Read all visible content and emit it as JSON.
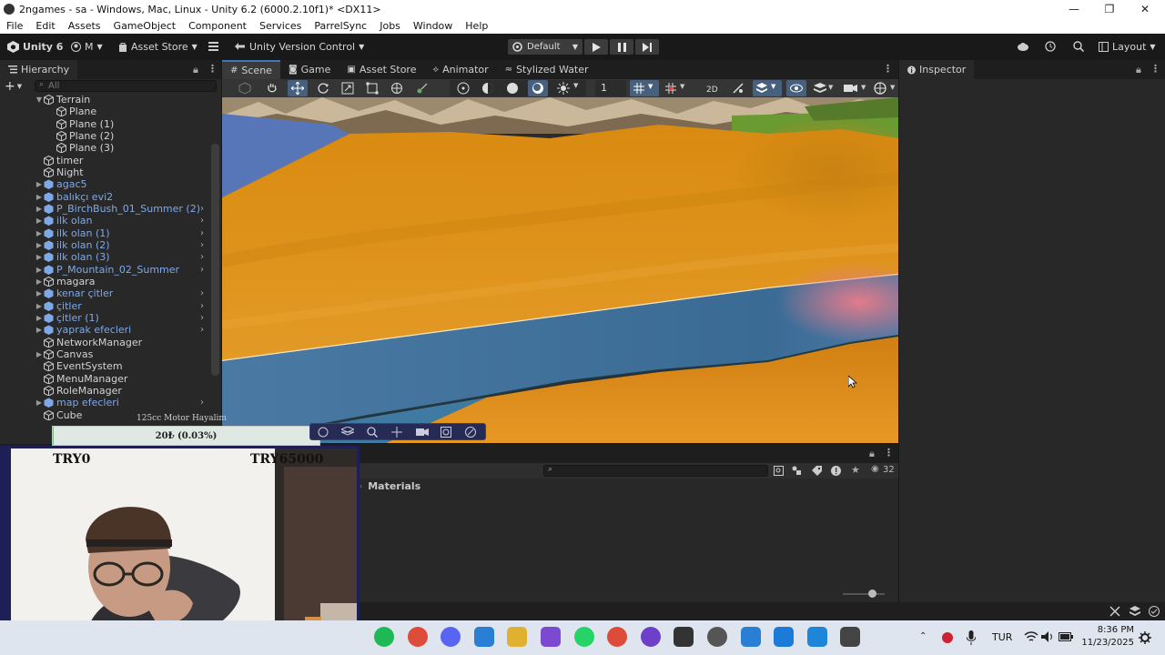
{
  "window": {
    "title": "2ngames - sa - Windows, Mac, Linux - Unity 6.2 (6000.2.10f1)* <DX11>",
    "controls": [
      "—",
      "❐",
      "✕"
    ]
  },
  "menu": [
    "File",
    "Edit",
    "Assets",
    "GameObject",
    "Component",
    "Services",
    "ParrelSync",
    "Jobs",
    "Window",
    "Help"
  ],
  "toolbar": {
    "unity_label": "Unity 6",
    "account_label": "M",
    "asset_store_label": "Asset Store",
    "version_control_label": "Unity Version Control",
    "build_profile_label": "Default",
    "layout_label": "Layout"
  },
  "hierarchy": {
    "tab_label": "Hierarchy",
    "search_placeholder": "All",
    "items": [
      {
        "label": "Terrain",
        "indent": 1,
        "expand": "down",
        "prefab": false
      },
      {
        "label": "Plane",
        "indent": 2,
        "expand": "",
        "prefab": false
      },
      {
        "label": "Plane (1)",
        "indent": 2,
        "expand": "",
        "prefab": false
      },
      {
        "label": "Plane (2)",
        "indent": 2,
        "expand": "",
        "prefab": false
      },
      {
        "label": "Plane (3)",
        "indent": 2,
        "expand": "",
        "prefab": false
      },
      {
        "label": "timer",
        "indent": 1,
        "expand": "",
        "prefab": false
      },
      {
        "label": "Night",
        "indent": 1,
        "expand": "",
        "prefab": false
      },
      {
        "label": "agac5",
        "indent": 1,
        "expand": "right",
        "prefab": true
      },
      {
        "label": "balıkçı evi2",
        "indent": 1,
        "expand": "right",
        "prefab": true
      },
      {
        "label": "P_BirchBush_01_Summer (2)",
        "indent": 1,
        "expand": "right",
        "prefab": true,
        "chevron": true
      },
      {
        "label": "ilk olan",
        "indent": 1,
        "expand": "right",
        "prefab": true,
        "chevron": true
      },
      {
        "label": "ilk olan (1)",
        "indent": 1,
        "expand": "right",
        "prefab": true,
        "chevron": true
      },
      {
        "label": "ilk olan (2)",
        "indent": 1,
        "expand": "right",
        "prefab": true,
        "chevron": true
      },
      {
        "label": "ilk olan (3)",
        "indent": 1,
        "expand": "right",
        "prefab": true,
        "chevron": true
      },
      {
        "label": "P_Mountain_02_Summer",
        "indent": 1,
        "expand": "right",
        "prefab": true,
        "chevron": true
      },
      {
        "label": "magara",
        "indent": 1,
        "expand": "right",
        "prefab": false
      },
      {
        "label": "kenar çitler",
        "indent": 1,
        "expand": "right",
        "prefab": true,
        "chevron": true
      },
      {
        "label": "çitler",
        "indent": 1,
        "expand": "right",
        "prefab": true,
        "chevron": true
      },
      {
        "label": "çitler (1)",
        "indent": 1,
        "expand": "right",
        "prefab": true,
        "chevron": true
      },
      {
        "label": "yaprak efecleri",
        "indent": 1,
        "expand": "right",
        "prefab": true,
        "chevron": true
      },
      {
        "label": "NetworkManager",
        "indent": 1,
        "expand": "",
        "prefab": false
      },
      {
        "label": "Canvas",
        "indent": 1,
        "expand": "right",
        "prefab": false
      },
      {
        "label": "EventSystem",
        "indent": 1,
        "expand": "",
        "prefab": false
      },
      {
        "label": "MenuManager",
        "indent": 1,
        "expand": "",
        "prefab": false
      },
      {
        "label": "RoleManager",
        "indent": 1,
        "expand": "",
        "prefab": false
      },
      {
        "label": "map efecleri",
        "indent": 1,
        "expand": "right",
        "prefab": true,
        "chevron": true
      },
      {
        "label": "Cube",
        "indent": 1,
        "expand": "",
        "prefab": false
      }
    ]
  },
  "scene_tabs": [
    {
      "label": "Scene",
      "active": true,
      "icon": "grid-icon"
    },
    {
      "label": "Game",
      "active": false,
      "icon": "gamepad-icon"
    },
    {
      "label": "Asset Store",
      "active": false,
      "icon": "store-icon"
    },
    {
      "label": "Animator",
      "active": false,
      "icon": "animator-icon"
    },
    {
      "label": "Stylized Water",
      "active": false,
      "icon": "water-icon"
    }
  ],
  "scene_toolbar": {
    "camera_speed": "1"
  },
  "inspector": {
    "tab_label": "Inspector"
  },
  "project": {
    "folder_label": "Materials",
    "hidden_count": "32",
    "search_placeholder": ""
  },
  "stream_overlay": {
    "goal_title": "125cc Motor Hayalim",
    "goal_progress": "20₺ (0.03%)",
    "goal_fraction": 0.0003,
    "min_label": "TRY0",
    "max_label": "TRY65000"
  },
  "taskbar": {
    "language": "TUR",
    "time": "8:36 PM",
    "date": "11/23/2025",
    "apps": [
      "spotify-icon",
      "chrome-icon",
      "discord-icon",
      "app-icon",
      "files-icon",
      "obsidian-icon",
      "whatsapp-icon",
      "chrome-icon",
      "github-icon",
      "unity-hub-icon",
      "obs-icon",
      "app-icon",
      "shield-icon",
      "vscode-icon",
      "unity-icon"
    ]
  },
  "colors": {
    "accent_blue": "#3a79bb",
    "prefab_blue": "#7fa9e6",
    "terrain_orange": "#e0901c",
    "water_blue": "#3b6f98"
  }
}
